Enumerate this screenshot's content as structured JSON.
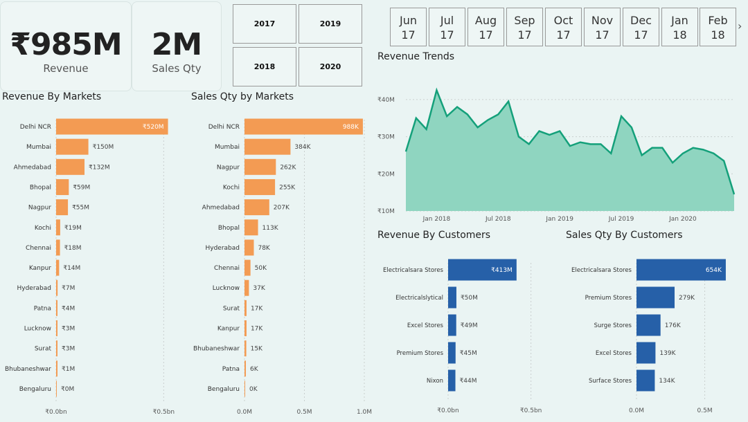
{
  "kpis": {
    "revenue": {
      "value": "₹985M",
      "label": "Revenue"
    },
    "qty": {
      "value": "2M",
      "label": "Sales Qty"
    }
  },
  "year_slicer": [
    "2017",
    "2019",
    "2018",
    "2020"
  ],
  "month_slicer": {
    "items": [
      {
        "m": "Jun",
        "y": "17"
      },
      {
        "m": "Jul",
        "y": "17"
      },
      {
        "m": "Aug",
        "y": "17"
      },
      {
        "m": "Sep",
        "y": "17"
      },
      {
        "m": "Oct",
        "y": "17"
      },
      {
        "m": "Nov",
        "y": "17"
      },
      {
        "m": "Dec",
        "y": "17"
      },
      {
        "m": "Jan",
        "y": "18"
      },
      {
        "m": "Feb",
        "y": "18"
      }
    ],
    "next_icon": "chevron-right-icon"
  },
  "titles": {
    "rev_markets": "Revenue By Markets",
    "qty_markets": "Sales Qty by Markets",
    "trend": "Revenue Trends",
    "rev_customers": "Revenue By Customers",
    "qty_customers": "Sales Qty By Customers"
  },
  "colors": {
    "orange": "#f39b53",
    "blue": "#2660a8",
    "teal_fill": "#8fd5c0",
    "teal_line": "#14a07a"
  },
  "chart_data": [
    {
      "id": "rev_markets",
      "type": "bar",
      "orientation": "horizontal",
      "categories": [
        "Delhi NCR",
        "Mumbai",
        "Ahmedabad",
        "Bhopal",
        "Nagpur",
        "Kochi",
        "Chennai",
        "Kanpur",
        "Hyderabad",
        "Patna",
        "Lucknow",
        "Surat",
        "Bhubaneshwar",
        "Bengaluru"
      ],
      "values": [
        520,
        150,
        132,
        59,
        55,
        19,
        18,
        14,
        7,
        4,
        3,
        3,
        1,
        0
      ],
      "labels": [
        "₹520M",
        "₹150M",
        "₹132M",
        "₹59M",
        "₹55M",
        "₹19M",
        "₹18M",
        "₹14M",
        "₹7M",
        "₹4M",
        "₹3M",
        "₹3M",
        "₹1M",
        "₹0M"
      ],
      "xlim": [
        0,
        560
      ],
      "xticks": [
        {
          "v": 0,
          "label": "₹0.0bn"
        },
        {
          "v": 500,
          "label": "₹0.5bn"
        }
      ]
    },
    {
      "id": "qty_markets",
      "type": "bar",
      "orientation": "horizontal",
      "categories": [
        "Delhi NCR",
        "Mumbai",
        "Nagpur",
        "Kochi",
        "Ahmedabad",
        "Bhopal",
        "Hyderabad",
        "Chennai",
        "Lucknow",
        "Surat",
        "Kanpur",
        "Bhubaneshwar",
        "Patna",
        "Bengaluru"
      ],
      "values": [
        988,
        384,
        262,
        255,
        207,
        113,
        78,
        50,
        37,
        17,
        17,
        15,
        6,
        0
      ],
      "labels": [
        "988K",
        "384K",
        "262K",
        "255K",
        "207K",
        "113K",
        "78K",
        "50K",
        "37K",
        "17K",
        "17K",
        "15K",
        "6K",
        "0K"
      ],
      "xlim": [
        0,
        1000
      ],
      "xticks": [
        {
          "v": 0,
          "label": "0.0M"
        },
        {
          "v": 500,
          "label": "0.5M"
        },
        {
          "v": 1000,
          "label": "1.0M"
        }
      ]
    },
    {
      "id": "trend",
      "type": "area",
      "y_unit": "₹M",
      "values": [
        26,
        35,
        32,
        42.5,
        35.5,
        38,
        36,
        32.5,
        34.5,
        36,
        39.5,
        30,
        28,
        31.5,
        30.5,
        31.5,
        27.5,
        28.5,
        28,
        28,
        25.5,
        35.5,
        32.5,
        25,
        27,
        27,
        23,
        25.5,
        27,
        26.5,
        25.5,
        23.5,
        14.5
      ],
      "ylim": [
        10,
        45
      ],
      "yticks": [
        {
          "v": 10,
          "label": "₹10M"
        },
        {
          "v": 20,
          "label": "₹20M"
        },
        {
          "v": 30,
          "label": "₹30M"
        },
        {
          "v": 40,
          "label": "₹40M"
        }
      ],
      "xticks": [
        {
          "i": 3,
          "label": "Jan 2018"
        },
        {
          "i": 9,
          "label": "Jul 2018"
        },
        {
          "i": 15,
          "label": "Jan 2019"
        },
        {
          "i": 21,
          "label": "Jul 2019"
        },
        {
          "i": 27,
          "label": "Jan 2020"
        }
      ]
    },
    {
      "id": "rev_customers",
      "type": "bar",
      "orientation": "horizontal",
      "categories": [
        "Electricalsara Stores",
        "Electricalslytical",
        "Excel Stores",
        "Premium Stores",
        "Nixon"
      ],
      "values": [
        413,
        50,
        49,
        45,
        44
      ],
      "labels": [
        "₹413M",
        "₹50M",
        "₹49M",
        "₹45M",
        "₹44M"
      ],
      "xlim": [
        0,
        560
      ],
      "xticks": [
        {
          "v": 0,
          "label": "₹0.0bn"
        },
        {
          "v": 500,
          "label": "₹0.5bn"
        }
      ]
    },
    {
      "id": "qty_customers",
      "type": "bar",
      "orientation": "horizontal",
      "categories": [
        "Electricalsara Stores",
        "Premium Stores",
        "Surge Stores",
        "Excel Stores",
        "Surface Stores"
      ],
      "values": [
        654,
        279,
        176,
        139,
        134
      ],
      "labels": [
        "654K",
        "279K",
        "176K",
        "139K",
        "134K"
      ],
      "xlim": [
        0,
        700
      ],
      "xticks": [
        {
          "v": 0,
          "label": "0.0M"
        },
        {
          "v": 500,
          "label": "0.5M"
        }
      ]
    }
  ]
}
